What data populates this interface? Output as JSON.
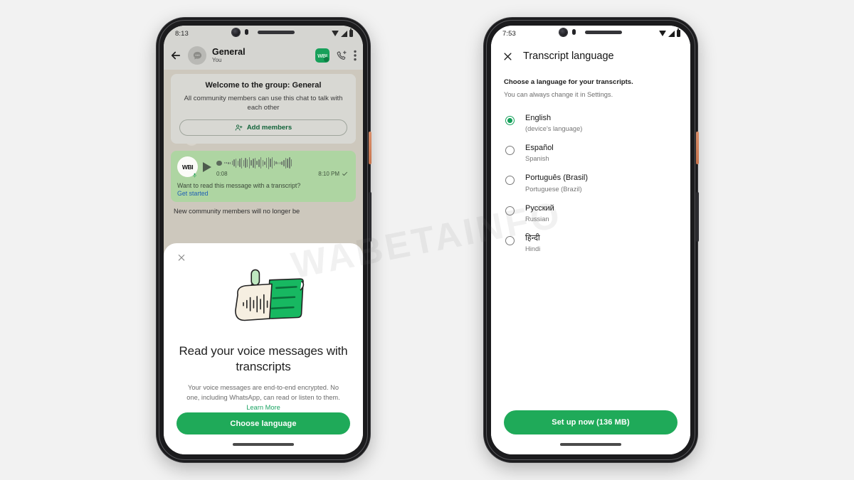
{
  "watermark": "WABETAINFO",
  "left_phone": {
    "status_bar": {
      "time": "8:13",
      "icons": [
        "wifi-icon",
        "signal-icon",
        "battery-icon"
      ]
    },
    "chat_header": {
      "back_icon": "back-arrow-icon",
      "avatar_icon": "group-avatar-icon",
      "name": "General",
      "subtitle": "You",
      "badge_label": "WBI",
      "call_icon": "add-to-call-icon",
      "overflow_icon": "overflow-menu-icon"
    },
    "system_card": {
      "title": "Welcome to the group: General",
      "text": "All community members can use this chat to talk with each other",
      "add_members_label": "Add members",
      "add_members_icon": "add-person-icon"
    },
    "voice_message": {
      "avatar_label": "WBI",
      "mic_icon": "microphone-icon",
      "play_icon": "play-icon",
      "duration": "0:08",
      "timestamp": "8:10 PM",
      "status_icon": "sent-check-icon",
      "prompt": "Want to read this message with a transcript?",
      "link_label": "Get started"
    },
    "tail_message": "New community members will no longer be",
    "sheet": {
      "close_icon": "close-icon",
      "illustration": "voice-transcript-illustration",
      "title": "Read your voice messages with transcripts",
      "body_prefix": "Your voice messages are end-to-end encrypted. No one, including WhatsApp, can read or listen to them. ",
      "learn_more_label": "Learn More",
      "cta_label": "Choose language"
    },
    "nav_pill": "home-gesture-pill"
  },
  "right_phone": {
    "status_bar": {
      "time": "7:53",
      "icons": [
        "wifi-icon",
        "signal-icon",
        "battery-icon"
      ]
    },
    "header": {
      "close_icon": "close-icon",
      "title": "Transcript language"
    },
    "intro": {
      "strong": "Choose a language for your transcripts.",
      "sub": "You can always change it in Settings."
    },
    "languages": [
      {
        "native": "English",
        "english": "(device's language)",
        "selected": true
      },
      {
        "native": "Español",
        "english": "Spanish",
        "selected": false
      },
      {
        "native": "Português (Brasil)",
        "english": "Portuguese (Brazil)",
        "selected": false
      },
      {
        "native": "Русский",
        "english": "Russian",
        "selected": false
      },
      {
        "native": "हिन्दी",
        "english": "Hindi",
        "selected": false
      }
    ],
    "cta_label": "Set up now (136 MB)",
    "nav_pill": "home-gesture-pill"
  },
  "colors": {
    "brand_green": "#1faa59",
    "radio_green": "#14a05a",
    "link_blue": "#1e5fb4",
    "learn_more_green": "#1aa463",
    "page_bg": "#f2f2f2"
  }
}
